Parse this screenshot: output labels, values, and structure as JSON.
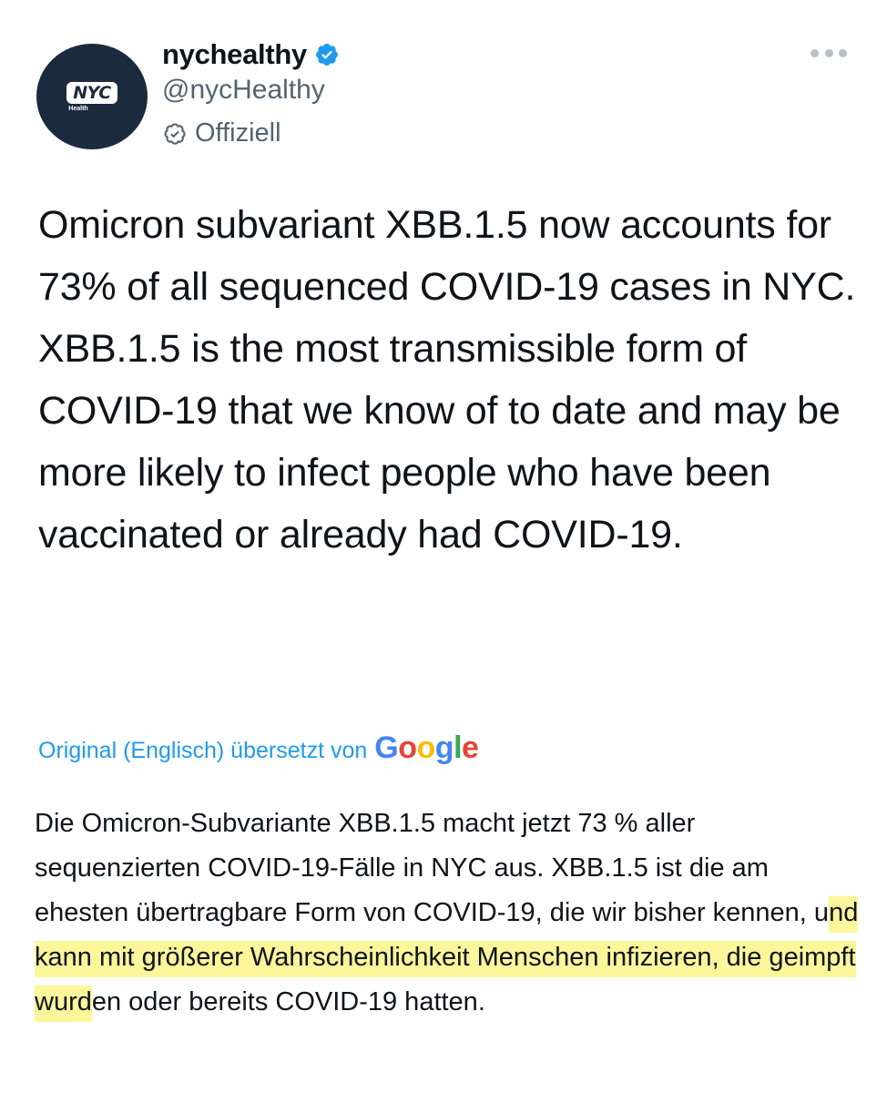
{
  "profile": {
    "avatar_text": "NYC",
    "avatar_subtext": "Health",
    "display_name": "nychealthy",
    "handle": "@nycHealthy",
    "official_label": "Offiziell"
  },
  "tweet": {
    "text": "Omicron subvariant XBB.1.5 now accounts for 73% of all sequenced COVID-19 cases in NYC. XBB.1.5 is the most transmissible form of COVID-19 that we know of to date and may be more likely to infect people who have been vaccinated or already had COVID-19."
  },
  "translation": {
    "link_text": "Original (Englisch) übersetzt von",
    "provider": "Google",
    "text_part1": "Die Omicron-Subvariante XBB.1.5 macht jetzt 73 % aller sequenzierten COVID-19-Fälle in NYC aus. XBB.1.5 ist die am ehesten übertragbare Form von COVID-19, die wir bisher kennen, u",
    "text_highlighted": "nd kann mit größerer Wahrscheinlichkeit Menschen infizieren, die geimpft wurd",
    "text_part2": "en oder bereits COVID-19 hatten."
  },
  "colors": {
    "verified_blue": "#1d9bf0",
    "highlight_yellow": "#fbf69a",
    "avatar_bg": "#1b2a3d",
    "google_blue": "#4285f4",
    "google_red": "#ea4335",
    "google_yellow": "#fbbc05",
    "google_green": "#34a853"
  },
  "icons": {
    "verified": "verified-badge-icon",
    "official": "official-check-icon",
    "more": "more-options-icon"
  }
}
